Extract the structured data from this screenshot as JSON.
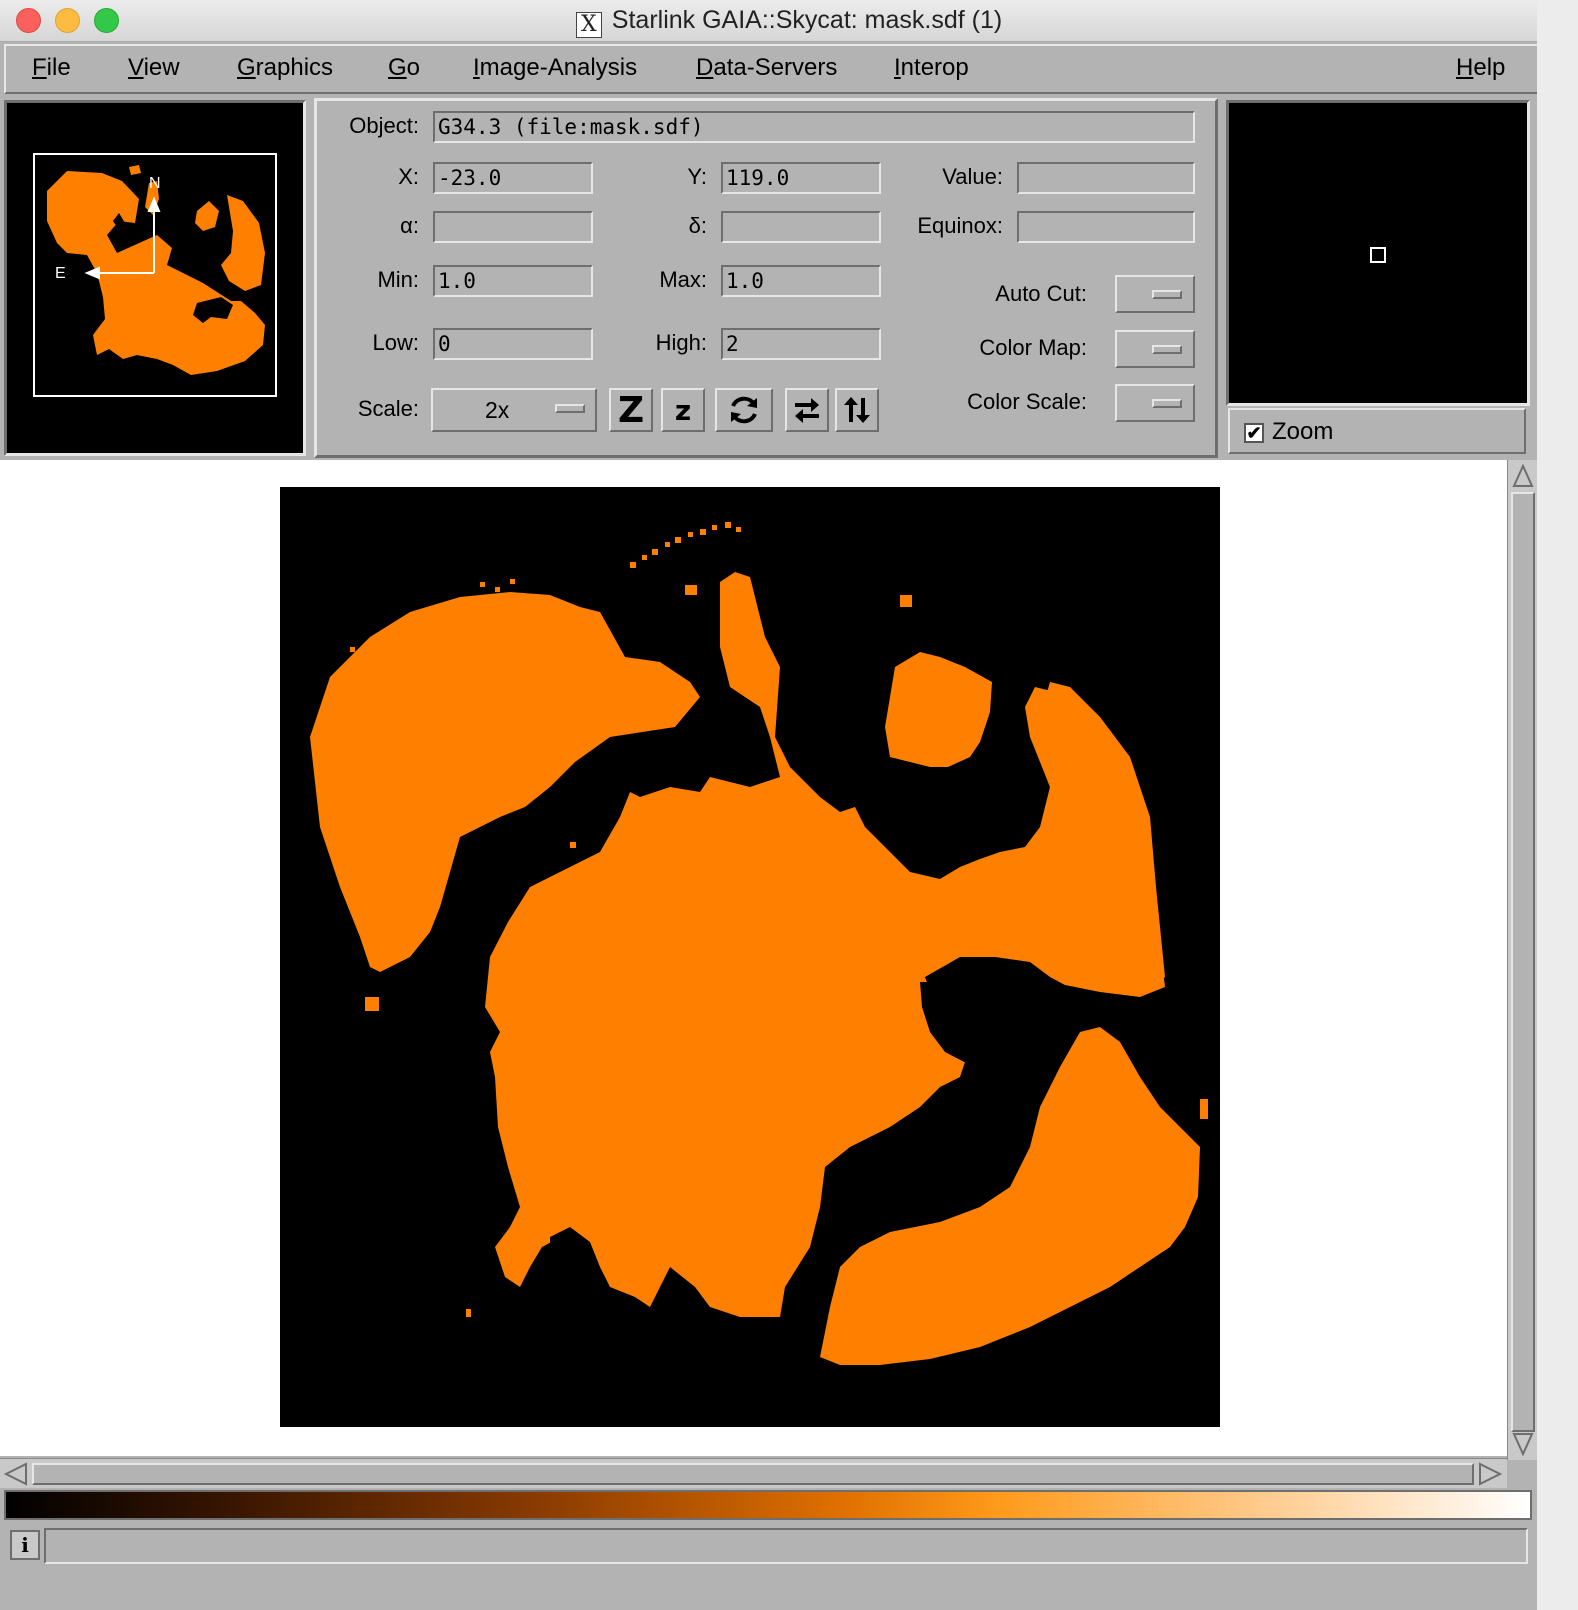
{
  "window": {
    "title": "Starlink GAIA::Skycat: mask.sdf (1)",
    "app_icon": "x-icon"
  },
  "menu": [
    "File",
    "View",
    "Graphics",
    "Go",
    "Image-Analysis",
    "Data-Servers",
    "Interop"
  ],
  "help": "Help",
  "panner": {
    "compass_n": "N",
    "compass_e": "E"
  },
  "info": {
    "object_label": "Object:",
    "object_value": "G34.3 (file:mask.sdf)",
    "x_label": "X:",
    "x_value": "-23.0",
    "y_label": "Y:",
    "y_value": "119.0",
    "value_label": "Value:",
    "value_value": "",
    "alpha_label": "α:",
    "alpha_value": "",
    "delta_label": "δ:",
    "delta_value": "",
    "equinox_label": "Equinox:",
    "equinox_value": "",
    "min_label": "Min:",
    "min_value": "1.0",
    "max_label": "Max:",
    "max_value": "1.0",
    "low_label": "Low:",
    "low_value": "0",
    "high_label": "High:",
    "high_value": "2",
    "autocut_label": "Auto Cut:",
    "colormap_label": "Color Map:",
    "colorscale_label": "Color Scale:",
    "scale_label": "Scale:",
    "scale_value": "2x"
  },
  "toolbar": {
    "icons": [
      "zoom-in-icon",
      "zoom-out-icon",
      "rotate-icon",
      "flip-x-icon",
      "flip-y-icon"
    ],
    "zoom_in_glyph": "Z",
    "zoom_out_glyph": "z"
  },
  "zoom": {
    "label": "Zoom",
    "checked": true,
    "check_glyph": "✔"
  },
  "status": {
    "info_glyph": "i",
    "text": ""
  },
  "colors": {
    "mask": "#ff8000",
    "background": "#000000",
    "panel": "#b3b3b3"
  }
}
